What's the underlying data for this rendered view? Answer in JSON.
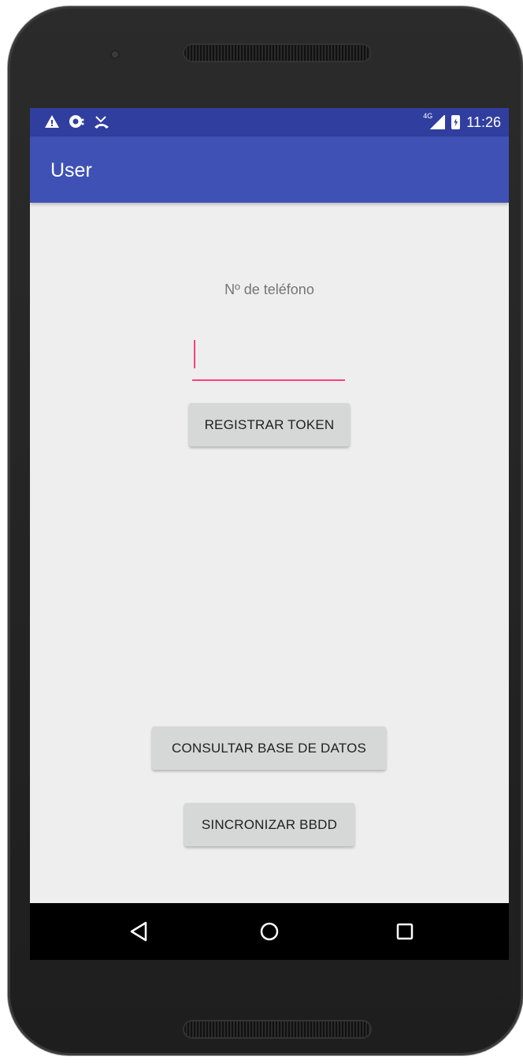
{
  "status_bar": {
    "time": "11:26",
    "network": "4G",
    "notification_icons": [
      "warning-icon",
      "signal-chat-icon",
      "missed-call-icon"
    ],
    "bg_color": "#303f9f"
  },
  "toolbar": {
    "title": "User",
    "bg_color": "#3f51b5"
  },
  "form": {
    "phone_label": "Nº de teléfono",
    "phone_value": "",
    "accent_color": "#ff4081"
  },
  "buttons": {
    "register_token": "REGISTRAR TOKEN",
    "query_database": "CONSULTAR BASE DE DATOS",
    "sync_database": "SINCRONIZAR BBDD"
  },
  "nav_bar": {
    "icons": [
      "back-icon",
      "home-icon",
      "recents-icon"
    ]
  }
}
